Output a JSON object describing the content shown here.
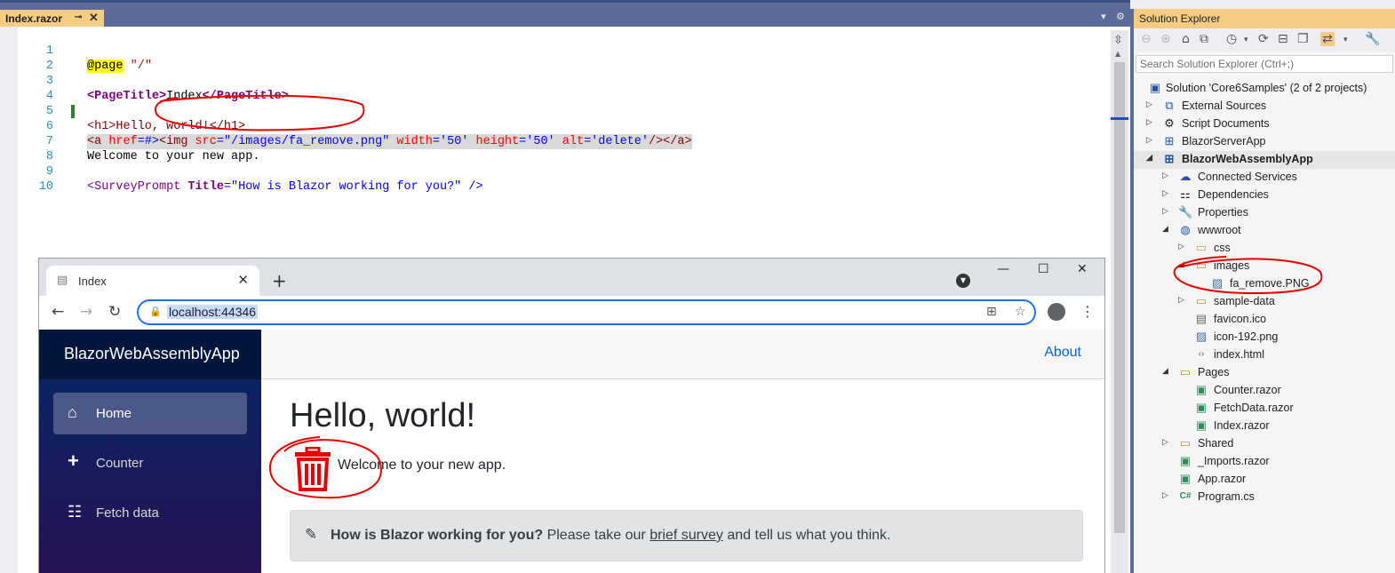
{
  "document_tab": {
    "title": "Index.razor",
    "pin_icon": "pin-icon",
    "close": "✕"
  },
  "tab_controls": {
    "dropdown": "▾",
    "settings": "⚙"
  },
  "editor": {
    "lines": [
      {
        "num": "1"
      },
      {
        "num": "2"
      },
      {
        "num": "3"
      },
      {
        "num": "4"
      },
      {
        "num": "5"
      },
      {
        "num": "6"
      },
      {
        "num": "7"
      },
      {
        "num": "8"
      },
      {
        "num": "9"
      },
      {
        "num": "10"
      }
    ],
    "code": {
      "l1_dir": "@page",
      "l1_str": " \"/\"",
      "l3_open": "<PageTitle>",
      "l3_text": "Index",
      "l3_close": "</PageTitle>",
      "l5": "<h1>Hello, world!</h1>",
      "l6_a": "<a ",
      "l6_href": "href",
      "l6_eq": "=#>",
      "l6_imgopen": "<img ",
      "l6_src": "src",
      "l6_srcval": "=\"/images/fa_remove.png\"",
      "l6_width": " width",
      "l6_wval": "='50'",
      "l6_height": " height",
      "l6_hval": "='50'",
      "l6_alt": " alt",
      "l6_altval": "='delete'",
      "l6_end": "/></a>",
      "l7": "Welcome to your new app.",
      "l9_open": "<SurveyPrompt ",
      "l9_attr": "Title",
      "l9_val": "=\"How is Blazor working for you?\"",
      "l9_end": " />"
    }
  },
  "solution_explorer": {
    "title": "Solution Explorer",
    "search_placeholder": "Search Solution Explorer (Ctrl+;)",
    "items": [
      {
        "label": "Solution 'Core6Samples' (2 of 2 projects)",
        "icon": "solution-icon"
      },
      {
        "label": "External Sources",
        "icon": "external-sources-icon"
      },
      {
        "label": "Script Documents",
        "icon": "script-documents-icon"
      },
      {
        "label": "BlazorServerApp",
        "icon": "project-icon"
      },
      {
        "label": "BlazorWebAssemblyApp",
        "icon": "project-icon"
      },
      {
        "label": "Connected Services",
        "icon": "connected-services-icon"
      },
      {
        "label": "Dependencies",
        "icon": "dependencies-icon"
      },
      {
        "label": "Properties",
        "icon": "properties-icon"
      },
      {
        "label": "wwwroot",
        "icon": "globe-icon"
      },
      {
        "label": "css",
        "icon": "folder-icon"
      },
      {
        "label": "images",
        "icon": "folder-open-icon"
      },
      {
        "label": "fa_remove.PNG",
        "icon": "image-file-icon"
      },
      {
        "label": "sample-data",
        "icon": "folder-icon"
      },
      {
        "label": "favicon.ico",
        "icon": "file-icon"
      },
      {
        "label": "icon-192.png",
        "icon": "image-file-icon"
      },
      {
        "label": "index.html",
        "icon": "html-file-icon"
      },
      {
        "label": "Pages",
        "icon": "folder-open-icon"
      },
      {
        "label": "Counter.razor",
        "icon": "razor-file-icon"
      },
      {
        "label": "FetchData.razor",
        "icon": "razor-file-icon"
      },
      {
        "label": "Index.razor",
        "icon": "razor-file-icon"
      },
      {
        "label": "Shared",
        "icon": "folder-icon"
      },
      {
        "label": "_Imports.razor",
        "icon": "razor-file-icon"
      },
      {
        "label": "App.razor",
        "icon": "razor-file-icon"
      },
      {
        "label": "Program.cs",
        "icon": "csharp-file-icon"
      }
    ]
  },
  "browser": {
    "tab_title": "Index",
    "url": "localhost:44346",
    "app": {
      "brand": "BlazorWebAssemblyApp",
      "nav": [
        {
          "label": "Home",
          "icon": "home-icon"
        },
        {
          "label": "Counter",
          "icon": "plus-icon"
        },
        {
          "label": "Fetch data",
          "icon": "list-icon"
        }
      ],
      "about": "About",
      "heading": "Hello, world!",
      "image_alt": "delete",
      "welcome": "Welcome to your new app.",
      "survey": {
        "question": "How is Blazor working for you?",
        "pre_link": " Please take our ",
        "link": "brief survey",
        "post_link": " and tell us what you think."
      }
    }
  },
  "colors": {
    "vs_accent": "#5d6b99",
    "vs_active_tab": "#f5cc84",
    "sidebar_top": "#052767",
    "annotation_red": "#e60000",
    "link_blue": "#0366d6"
  }
}
